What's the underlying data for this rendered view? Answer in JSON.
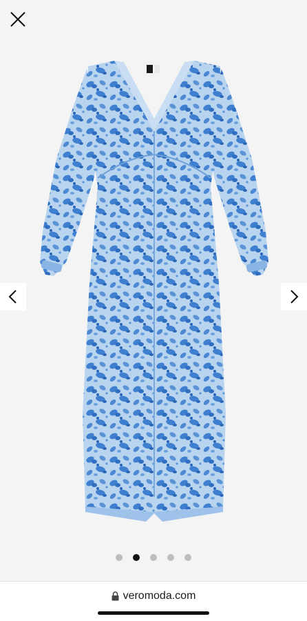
{
  "viewer": {
    "close_icon": "close-icon",
    "prev_icon": "chevron-left-icon",
    "next_icon": "chevron-right-icon",
    "image_count": 5,
    "active_image": 2
  },
  "address_bar": {
    "lock_icon": "lock-icon",
    "domain": "veromoda.com"
  },
  "colors": {
    "background": "#f4f4f4",
    "dress_base": "#b9d4ee",
    "dress_print": "#3f7fcf",
    "dot_active": "#111111",
    "dot_inactive": "#bdbdbd"
  }
}
